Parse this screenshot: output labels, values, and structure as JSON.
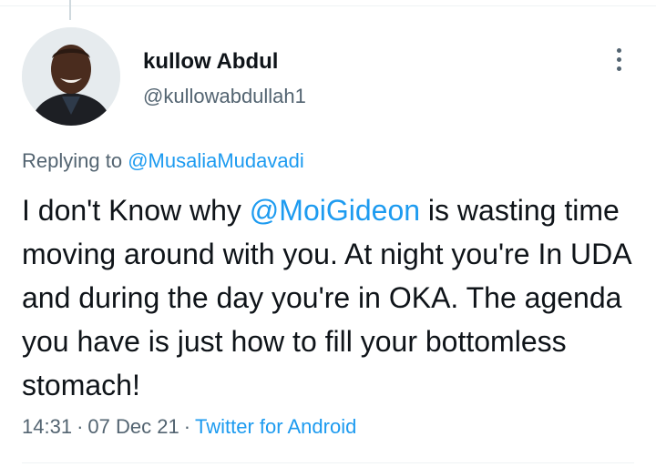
{
  "tweet": {
    "author": {
      "display_name": "kullow Abdul",
      "handle": "@kullowabdullah1"
    },
    "reply_label": "Replying to",
    "reply_mention": "@MusaliaMudavadi",
    "text_before_mention": "I don't Know why ",
    "text_mention": "@MoiGideon",
    "text_after_mention": " is wasting time moving around with you. At night you're In UDA and during the day you're in OKA. The agenda you have is just how to fill your bottomless stomach!",
    "time": "14:31",
    "date": "07 Dec 21",
    "source": "Twitter for Android",
    "separator": "·"
  },
  "icons": {
    "more": "more-options-icon"
  },
  "colors": {
    "link": "#1d9bf0",
    "secondary_text": "#536471",
    "primary_text": "#0f1419"
  }
}
